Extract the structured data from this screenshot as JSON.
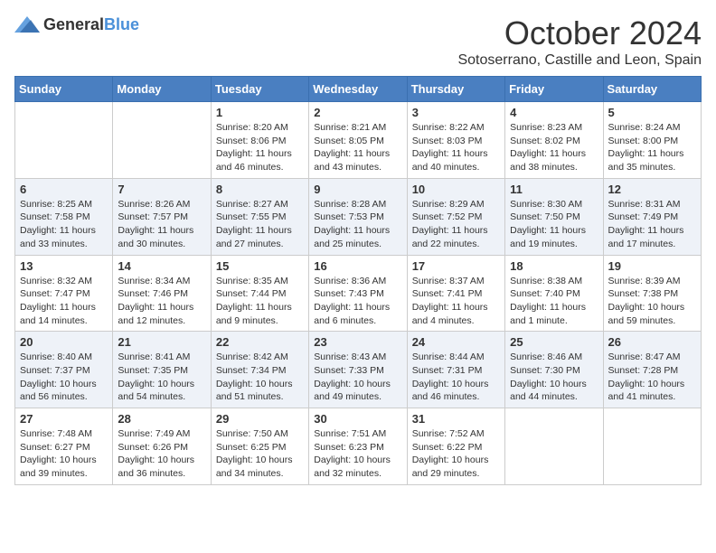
{
  "header": {
    "logo_general": "General",
    "logo_blue": "Blue",
    "month_title": "October 2024",
    "location": "Sotoserrano, Castille and Leon, Spain"
  },
  "days_of_week": [
    "Sunday",
    "Monday",
    "Tuesday",
    "Wednesday",
    "Thursday",
    "Friday",
    "Saturday"
  ],
  "weeks": [
    [
      {
        "day": "",
        "info": ""
      },
      {
        "day": "",
        "info": ""
      },
      {
        "day": "1",
        "sunrise": "Sunrise: 8:20 AM",
        "sunset": "Sunset: 8:06 PM",
        "daylight": "Daylight: 11 hours and 46 minutes."
      },
      {
        "day": "2",
        "sunrise": "Sunrise: 8:21 AM",
        "sunset": "Sunset: 8:05 PM",
        "daylight": "Daylight: 11 hours and 43 minutes."
      },
      {
        "day": "3",
        "sunrise": "Sunrise: 8:22 AM",
        "sunset": "Sunset: 8:03 PM",
        "daylight": "Daylight: 11 hours and 40 minutes."
      },
      {
        "day": "4",
        "sunrise": "Sunrise: 8:23 AM",
        "sunset": "Sunset: 8:02 PM",
        "daylight": "Daylight: 11 hours and 38 minutes."
      },
      {
        "day": "5",
        "sunrise": "Sunrise: 8:24 AM",
        "sunset": "Sunset: 8:00 PM",
        "daylight": "Daylight: 11 hours and 35 minutes."
      }
    ],
    [
      {
        "day": "6",
        "sunrise": "Sunrise: 8:25 AM",
        "sunset": "Sunset: 7:58 PM",
        "daylight": "Daylight: 11 hours and 33 minutes."
      },
      {
        "day": "7",
        "sunrise": "Sunrise: 8:26 AM",
        "sunset": "Sunset: 7:57 PM",
        "daylight": "Daylight: 11 hours and 30 minutes."
      },
      {
        "day": "8",
        "sunrise": "Sunrise: 8:27 AM",
        "sunset": "Sunset: 7:55 PM",
        "daylight": "Daylight: 11 hours and 27 minutes."
      },
      {
        "day": "9",
        "sunrise": "Sunrise: 8:28 AM",
        "sunset": "Sunset: 7:53 PM",
        "daylight": "Daylight: 11 hours and 25 minutes."
      },
      {
        "day": "10",
        "sunrise": "Sunrise: 8:29 AM",
        "sunset": "Sunset: 7:52 PM",
        "daylight": "Daylight: 11 hours and 22 minutes."
      },
      {
        "day": "11",
        "sunrise": "Sunrise: 8:30 AM",
        "sunset": "Sunset: 7:50 PM",
        "daylight": "Daylight: 11 hours and 19 minutes."
      },
      {
        "day": "12",
        "sunrise": "Sunrise: 8:31 AM",
        "sunset": "Sunset: 7:49 PM",
        "daylight": "Daylight: 11 hours and 17 minutes."
      }
    ],
    [
      {
        "day": "13",
        "sunrise": "Sunrise: 8:32 AM",
        "sunset": "Sunset: 7:47 PM",
        "daylight": "Daylight: 11 hours and 14 minutes."
      },
      {
        "day": "14",
        "sunrise": "Sunrise: 8:34 AM",
        "sunset": "Sunset: 7:46 PM",
        "daylight": "Daylight: 11 hours and 12 minutes."
      },
      {
        "day": "15",
        "sunrise": "Sunrise: 8:35 AM",
        "sunset": "Sunset: 7:44 PM",
        "daylight": "Daylight: 11 hours and 9 minutes."
      },
      {
        "day": "16",
        "sunrise": "Sunrise: 8:36 AM",
        "sunset": "Sunset: 7:43 PM",
        "daylight": "Daylight: 11 hours and 6 minutes."
      },
      {
        "day": "17",
        "sunrise": "Sunrise: 8:37 AM",
        "sunset": "Sunset: 7:41 PM",
        "daylight": "Daylight: 11 hours and 4 minutes."
      },
      {
        "day": "18",
        "sunrise": "Sunrise: 8:38 AM",
        "sunset": "Sunset: 7:40 PM",
        "daylight": "Daylight: 11 hours and 1 minute."
      },
      {
        "day": "19",
        "sunrise": "Sunrise: 8:39 AM",
        "sunset": "Sunset: 7:38 PM",
        "daylight": "Daylight: 10 hours and 59 minutes."
      }
    ],
    [
      {
        "day": "20",
        "sunrise": "Sunrise: 8:40 AM",
        "sunset": "Sunset: 7:37 PM",
        "daylight": "Daylight: 10 hours and 56 minutes."
      },
      {
        "day": "21",
        "sunrise": "Sunrise: 8:41 AM",
        "sunset": "Sunset: 7:35 PM",
        "daylight": "Daylight: 10 hours and 54 minutes."
      },
      {
        "day": "22",
        "sunrise": "Sunrise: 8:42 AM",
        "sunset": "Sunset: 7:34 PM",
        "daylight": "Daylight: 10 hours and 51 minutes."
      },
      {
        "day": "23",
        "sunrise": "Sunrise: 8:43 AM",
        "sunset": "Sunset: 7:33 PM",
        "daylight": "Daylight: 10 hours and 49 minutes."
      },
      {
        "day": "24",
        "sunrise": "Sunrise: 8:44 AM",
        "sunset": "Sunset: 7:31 PM",
        "daylight": "Daylight: 10 hours and 46 minutes."
      },
      {
        "day": "25",
        "sunrise": "Sunrise: 8:46 AM",
        "sunset": "Sunset: 7:30 PM",
        "daylight": "Daylight: 10 hours and 44 minutes."
      },
      {
        "day": "26",
        "sunrise": "Sunrise: 8:47 AM",
        "sunset": "Sunset: 7:28 PM",
        "daylight": "Daylight: 10 hours and 41 minutes."
      }
    ],
    [
      {
        "day": "27",
        "sunrise": "Sunrise: 7:48 AM",
        "sunset": "Sunset: 6:27 PM",
        "daylight": "Daylight: 10 hours and 39 minutes."
      },
      {
        "day": "28",
        "sunrise": "Sunrise: 7:49 AM",
        "sunset": "Sunset: 6:26 PM",
        "daylight": "Daylight: 10 hours and 36 minutes."
      },
      {
        "day": "29",
        "sunrise": "Sunrise: 7:50 AM",
        "sunset": "Sunset: 6:25 PM",
        "daylight": "Daylight: 10 hours and 34 minutes."
      },
      {
        "day": "30",
        "sunrise": "Sunrise: 7:51 AM",
        "sunset": "Sunset: 6:23 PM",
        "daylight": "Daylight: 10 hours and 32 minutes."
      },
      {
        "day": "31",
        "sunrise": "Sunrise: 7:52 AM",
        "sunset": "Sunset: 6:22 PM",
        "daylight": "Daylight: 10 hours and 29 minutes."
      },
      {
        "day": "",
        "info": ""
      },
      {
        "day": "",
        "info": ""
      }
    ]
  ]
}
